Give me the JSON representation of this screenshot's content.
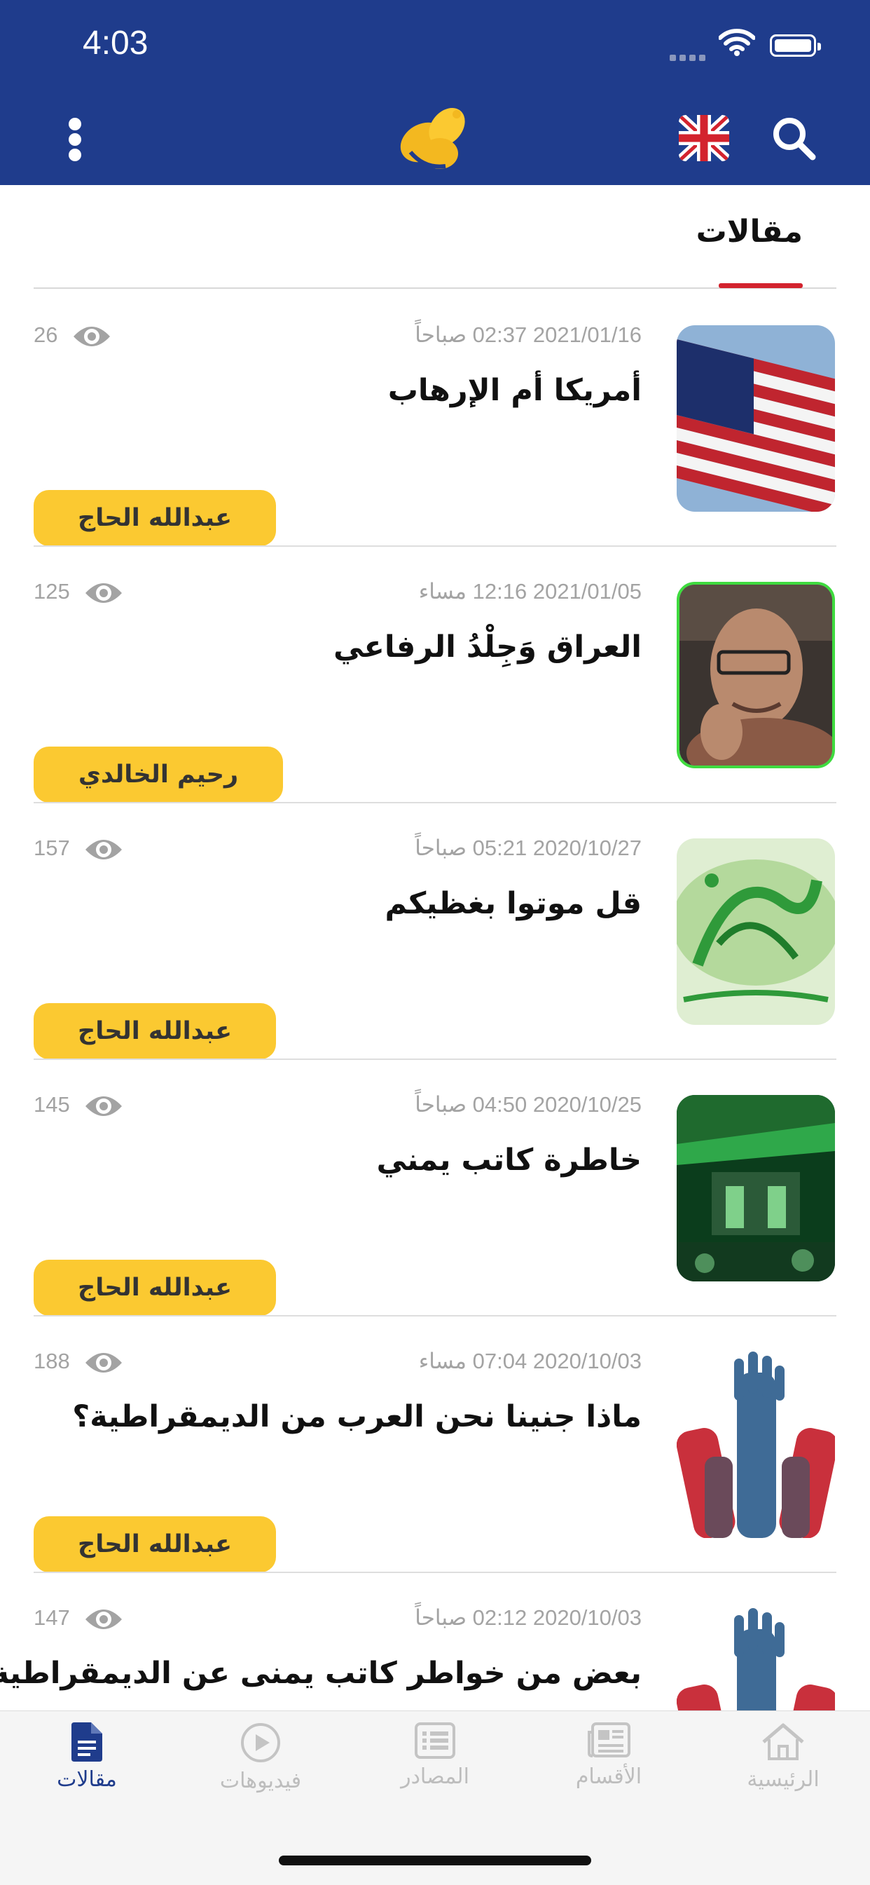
{
  "status_bar": {
    "time": "4:03"
  },
  "header": {
    "flag_icon": "uk-flag-icon",
    "brand_color": "#1f3c8c",
    "accent_yellow": "#fbc931"
  },
  "section": {
    "title": "مقالات"
  },
  "articles": [
    {
      "date": "2021/01/16 02:37 صباحاً",
      "views": "26",
      "title": "أمريكا أم الإرهاب",
      "author": "عبدالله الحاج",
      "thumb": "us-flag"
    },
    {
      "date": "2021/01/05 12:16 مساء",
      "views": "125",
      "title": "العراق وَجِلْدُ الرفاعي",
      "author": "رحيم الخالدي",
      "thumb": "portrait"
    },
    {
      "date": "2020/10/27 05:21 صباحاً",
      "views": "157",
      "title": "قل موتوا بغظيكم",
      "author": "عبدالله الحاج",
      "thumb": "calligraphy"
    },
    {
      "date": "2020/10/25 04:50 صباحاً",
      "views": "145",
      "title": "خاطرة كاتب يمني",
      "author": "عبدالله الحاج",
      "thumb": "green-gathering"
    },
    {
      "date": "2020/10/03 07:04 مساء",
      "views": "188",
      "title": "ماذا جنينا نحن العرب من الديمقراطية؟",
      "author": "عبدالله الحاج",
      "thumb": "raised-hands"
    },
    {
      "date": "2020/10/03 02:12 صباحاً",
      "views": "147",
      "title": "بعض من خواطر كاتب يمنى عن الديمقراطية",
      "author": "",
      "thumb": "raised-hands"
    }
  ],
  "tabbar": {
    "tabs": [
      {
        "label": "مقالات",
        "icon": "document-icon",
        "active": true
      },
      {
        "label": "فيديوهات",
        "icon": "play-icon",
        "active": false
      },
      {
        "label": "المصادر",
        "icon": "list-icon",
        "active": false
      },
      {
        "label": "الأقسام",
        "icon": "newspaper-icon",
        "active": false
      },
      {
        "label": "الرئيسية",
        "icon": "home-icon",
        "active": false
      }
    ]
  }
}
